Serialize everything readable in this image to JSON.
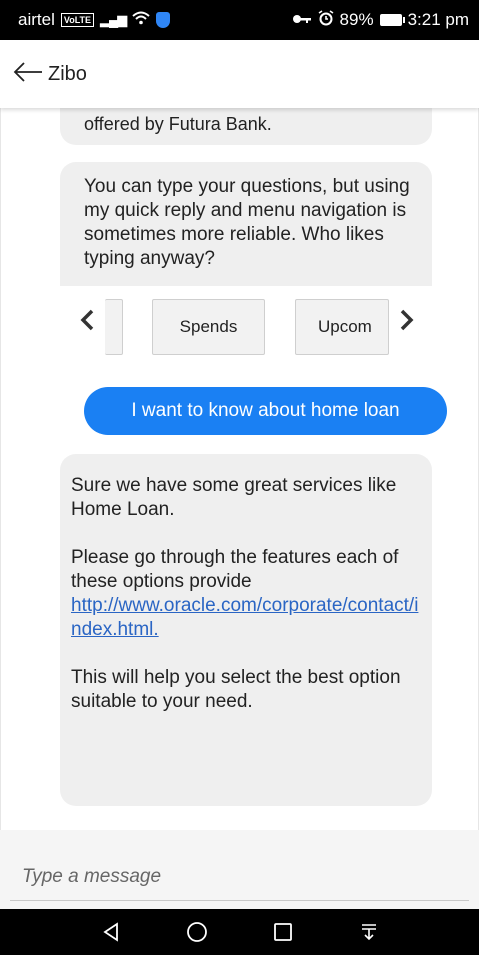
{
  "status_bar": {
    "carrier": "airtel",
    "network_badge": "VoLTE",
    "battery": "89%",
    "time": "3:21 pm",
    "icons": [
      "signal-icon",
      "wifi-icon",
      "shield-icon",
      "key-icon",
      "alarm-icon",
      "battery-icon"
    ]
  },
  "header": {
    "back_icon": "back-arrow-icon",
    "title": "Zibo"
  },
  "messages": {
    "bot_1": {
      "text_prefix": "offered by ",
      "text_bank": "Futura Bank",
      "text_suffix": "."
    },
    "bot_2": {
      "text": "You can type your questions, but using my quick reply and menu navigation is sometimes more reliable. Who likes typing anyway?"
    },
    "carousel": {
      "items": [
        {
          "label": ""
        },
        {
          "label": "Spends"
        },
        {
          "label": "Upcom"
        }
      ],
      "prev_icon": "chevron-left-icon",
      "next_icon": "chevron-right-icon"
    },
    "user_1": {
      "text": "I want to know about home loan"
    },
    "bot_3": {
      "p1": "Sure we have some great services like Home Loan.",
      "p2": "Please go through the features each of these options provide",
      "link": "http://www.oracle.com/corporate/contact/index.html.",
      "p3": "This will help you select the best option suitable to your need."
    }
  },
  "composer": {
    "placeholder": "Type a message"
  },
  "nav_bar": {
    "icons": [
      "back-triangle-icon",
      "home-circle-icon",
      "recents-square-icon",
      "notifications-pulldown-icon"
    ]
  },
  "colors": {
    "user_bubble": "#1a80f3",
    "bot_bubble": "#efefef",
    "link": "#2a65c4",
    "status_bar": "#000000"
  }
}
